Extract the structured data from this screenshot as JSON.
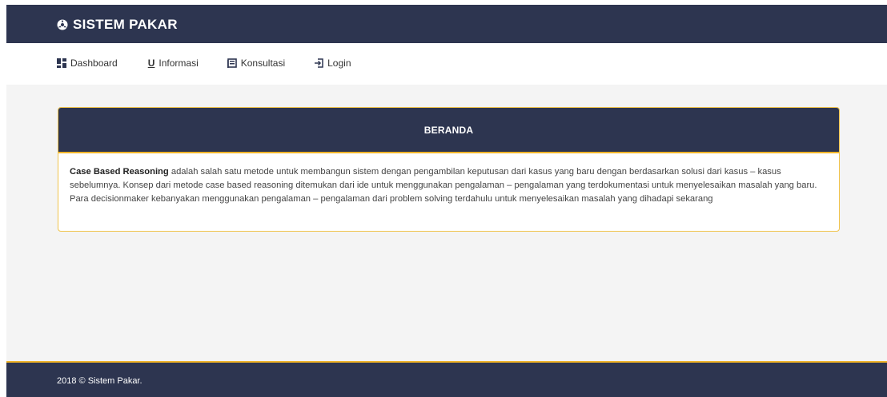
{
  "brand": {
    "title": "SISTEM PAKAR",
    "icon": "settings-icon"
  },
  "nav": {
    "items": [
      {
        "label": "Dashboard",
        "icon": "dashboard-grid-icon"
      },
      {
        "label": "Informasi",
        "icon": "underline-u-icon"
      },
      {
        "label": "Konsultasi",
        "icon": "book-icon"
      },
      {
        "label": "Login",
        "icon": "login-icon"
      }
    ]
  },
  "card": {
    "title": "BERANDA",
    "lead": "Case Based Reasoning",
    "text": " adalah salah satu metode untuk membangun sistem dengan pengambilan keputusan dari kasus yang baru dengan berdasarkan solusi dari kasus – kasus sebelumnya. Konsep dari metode case based reasoning ditemukan dari ide untuk menggunakan pengalaman – pengalaman yang terdokumentasi untuk menyelesaikan masalah yang baru. Para decisionmaker kebanyakan menggunakan pengalaman – pengalaman dari problem solving terdahulu untuk menyelesaikan masalah yang dihadapi sekarang"
  },
  "footer": {
    "text": "2018 © Sistem Pakar."
  },
  "colors": {
    "primary": "#2d3550",
    "accent": "#f0b429",
    "background": "#f4f4f4"
  }
}
